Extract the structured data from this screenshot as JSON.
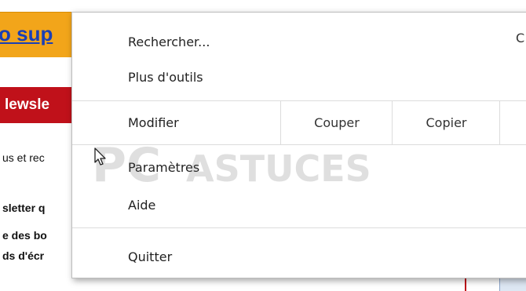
{
  "background": {
    "top_banner_text": "o sup",
    "red_banner_text": "lewsle",
    "lines": [
      {
        "text": "us et rec",
        "bold": false
      },
      {
        "text": "sletter q",
        "bold": true
      },
      {
        "text": "e des bo",
        "bold": true
      },
      {
        "text": "ds d'écr",
        "bold": true
      }
    ]
  },
  "menu": {
    "search_label": "Rechercher...",
    "more_tools_label": "Plus d'outils",
    "right_hint": "C",
    "edit_label": "Modifier",
    "cut_label": "Couper",
    "copy_label": "Copier",
    "settings_label": "Paramètres",
    "help_label": "Aide",
    "quit_label": "Quitter"
  },
  "watermark": {
    "left": "PC",
    "right": "ASTUCES"
  }
}
